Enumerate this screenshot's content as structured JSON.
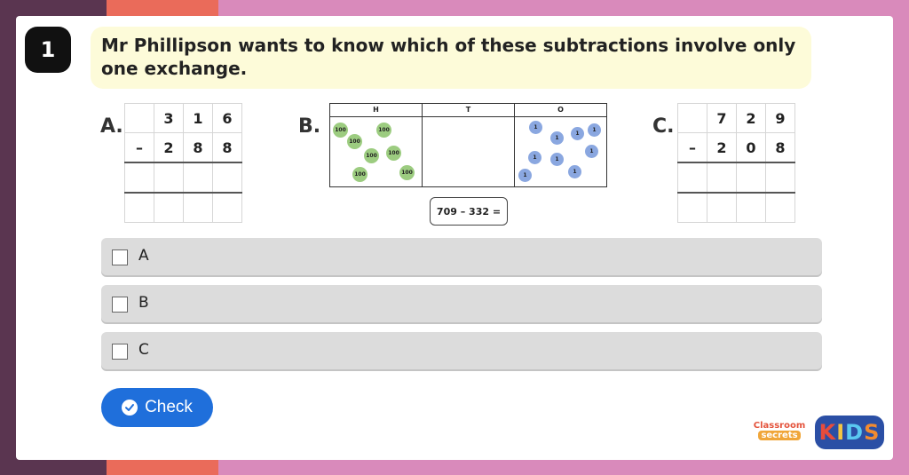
{
  "question": {
    "number": "1",
    "text": "Mr Phillipson wants to know which of these subtractions involve only one exchange."
  },
  "options": {
    "a": {
      "label": "A.",
      "top": [
        "",
        "3",
        "1",
        "6"
      ],
      "middle": [
        "–",
        "2",
        "8",
        "8"
      ],
      "answer": [
        "",
        "",
        "",
        ""
      ],
      "extra": [
        "",
        "",
        "",
        ""
      ]
    },
    "b": {
      "label": "B.",
      "headers": [
        "H",
        "T",
        "O"
      ],
      "hundreds": [
        "100",
        "100",
        "100",
        "100",
        "100",
        "100",
        "100"
      ],
      "ones": [
        "1",
        "1",
        "1",
        "1",
        "1",
        "1",
        "1",
        "1",
        "1"
      ],
      "equation": "709 – 332 ="
    },
    "c": {
      "label": "C.",
      "top": [
        "",
        "7",
        "2",
        "9"
      ],
      "middle": [
        "–",
        "2",
        "0",
        "8"
      ],
      "answer": [
        "",
        "",
        "",
        ""
      ],
      "extra": [
        "",
        "",
        "",
        ""
      ]
    }
  },
  "choices": [
    "A",
    "B",
    "C"
  ],
  "check_label": "Check",
  "logo": {
    "classroom": "Classroom",
    "secrets": "secrets",
    "kids": [
      "K",
      "I",
      "D",
      "S"
    ]
  },
  "colors": {
    "check_button": "#1f6fdb",
    "question_box": "#fdfbd9",
    "hundreds_counter": "#9ccc80",
    "ones_counter": "#8aa7e0"
  }
}
